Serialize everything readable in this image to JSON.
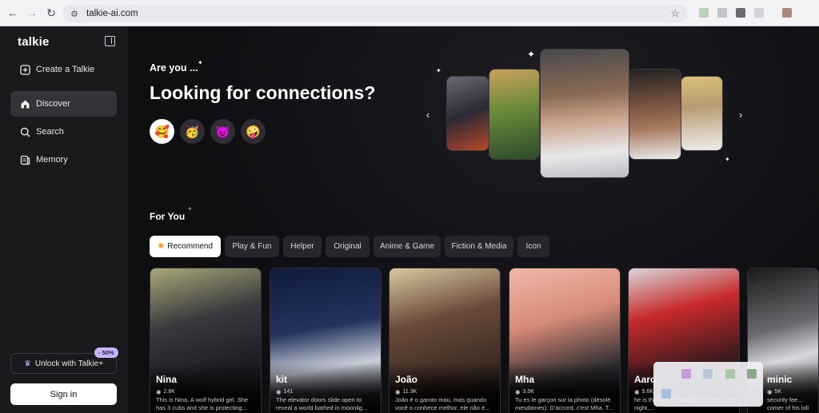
{
  "browser": {
    "url": "talkie-ai.com",
    "icons": [
      "back-icon",
      "forward-icon",
      "reload-icon",
      "site-info-icon",
      "bookmark-star-icon"
    ]
  },
  "sidebar": {
    "logo": "talkie",
    "items": [
      {
        "label": "Create a Talkie",
        "icon": "plus-square-icon"
      },
      {
        "label": "Discover",
        "icon": "home-icon",
        "active": true
      },
      {
        "label": "Search",
        "icon": "search-icon"
      },
      {
        "label": "Memory",
        "icon": "memory-icon"
      }
    ],
    "unlock_label": "Unlock with Talkie+",
    "discount_badge": "- 50%",
    "signin_label": "Sign in"
  },
  "hero": {
    "eyebrow": "Are you ...",
    "headline": "Looking for connections?",
    "moods": [
      "🥰",
      "🥳",
      "😈",
      "🤪"
    ]
  },
  "for_you": {
    "title": "For You",
    "tabs": [
      "Recommend",
      "Play & Fun",
      "Helper",
      "Original",
      "Anime & Game",
      "Fiction & Media",
      "Icon"
    ],
    "active_tab": "Recommend",
    "cards": [
      {
        "name": "Nina",
        "views": "2.8K",
        "desc": "This is Nina, A wolf hybrid girl. She has 3 cubs and she is protecting..."
      },
      {
        "name": "kit",
        "views": "141",
        "desc": "The elevator doors slide open to reveal a world bathed in moonlig..."
      },
      {
        "name": "João",
        "views": "11.3K",
        "desc": "João é o garoto mau, mas quando você o conhece melhor, ele não é..."
      },
      {
        "name": "Mha",
        "views": "3.5K",
        "desc": "Tu es le garçon sur la photo (désolé mesdames). D'accord, c'est Mha. T..."
      },
      {
        "name": "Aaro",
        "views": "5.6K",
        "desc": "he is th... are a (human) princess. one night,..."
      },
      {
        "name": "minic",
        "views": "5K",
        "desc": "security fee... comer of his bill"
      }
    ]
  },
  "colors": {
    "accent_purple": "#c9b3ff",
    "sidebar_bg": "#1a1a1d",
    "main_bg": "#0f0f12",
    "sun": "#ff9a1f"
  }
}
